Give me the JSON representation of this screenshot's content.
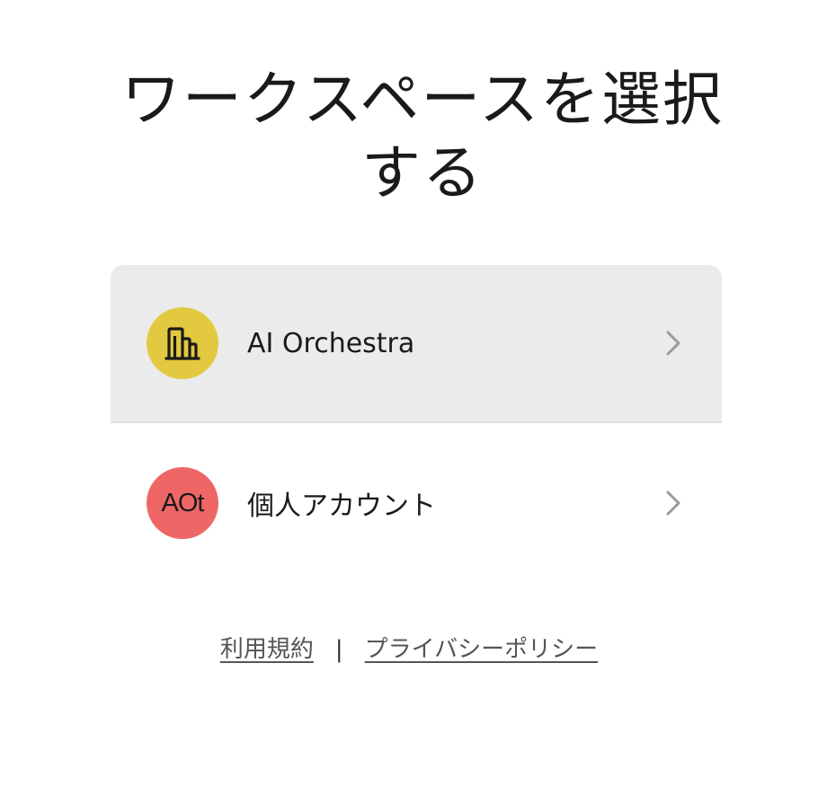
{
  "page": {
    "title": "ワークスペースを選択する"
  },
  "workspaces": [
    {
      "name": "AI Orchestra",
      "avatar_icon": "building-icon",
      "avatar_text": "",
      "avatar_color": "#e3c93f",
      "selected": true
    },
    {
      "name": "個人アカウント",
      "avatar_icon": "",
      "avatar_text": "AOt",
      "avatar_color": "#ee6766",
      "selected": false
    }
  ],
  "footer": {
    "terms_label": "利用規約",
    "separator": "|",
    "privacy_label": "プライバシーポリシー"
  },
  "colors": {
    "selected_bg": "#ebebeb",
    "divider": "#dcdcdc",
    "chevron": "#9a9a9a",
    "link": "#555555"
  }
}
